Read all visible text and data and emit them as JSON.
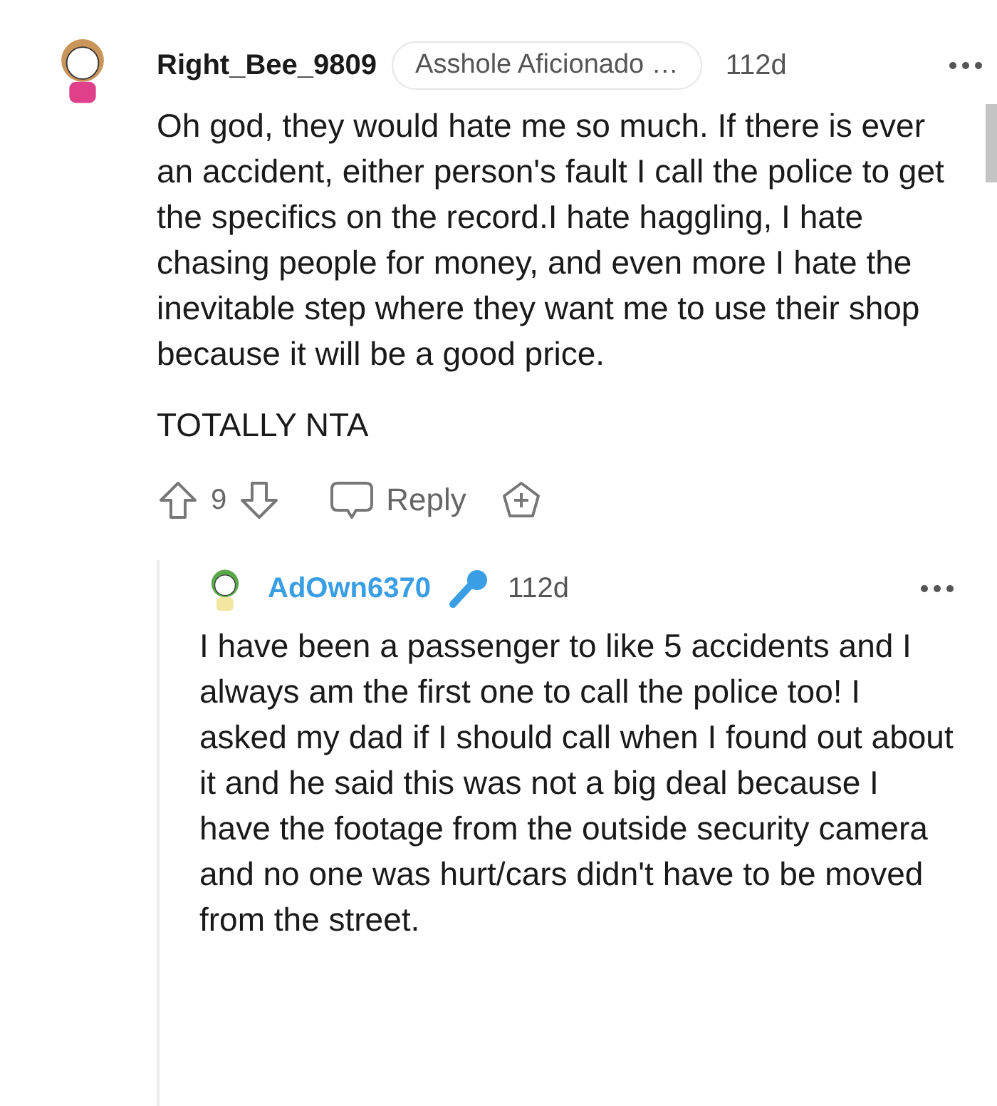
{
  "comments": [
    {
      "author": "Right_Bee_9809",
      "flair": "Asshole Aficionado …",
      "age": "112d",
      "body": [
        "Oh god, they would hate me so much. If there is ever an accident, either person's fault I call the police to get the specifics on the record.I hate haggling, I hate chasing people for money, and even more I hate the inevitable step where they want me to use their shop because it will be a good price.",
        "TOTALLY NTA"
      ],
      "score": "9",
      "reply": "Reply",
      "replies": [
        {
          "author": "AdOwn6370",
          "age": "112d",
          "body": [
            "I have been a passenger to like 5 accidents and I always am the first one to call the police too! I asked my dad if I should call when I found out about it and he said this was not a big deal because I have the footage from the outside security camera and no one was hurt/cars didn't have to be moved from the street."
          ]
        }
      ]
    }
  ]
}
